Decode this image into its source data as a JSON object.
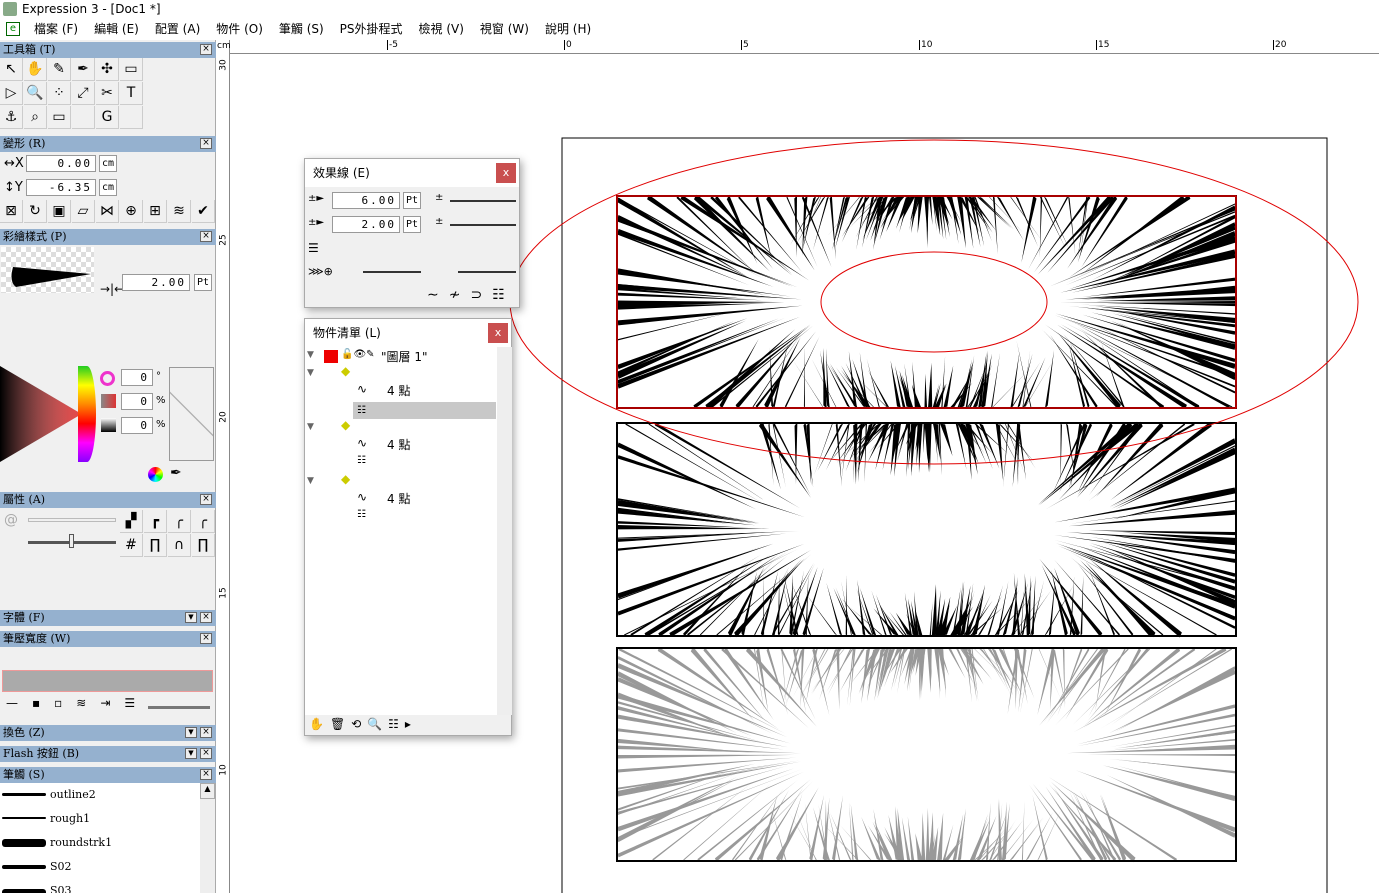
{
  "window": {
    "title": "Expression 3 - [Doc1 *]"
  },
  "menu": [
    "檔案 (F)",
    "編輯 (E)",
    "配置 (A)",
    "物件 (O)",
    "筆觸 (S)",
    "PS外掛程式",
    "檢視 (V)",
    "視窗 (W)",
    "說明 (H)"
  ],
  "panels": {
    "toolbox": {
      "title": "工具箱 (T)"
    },
    "transform": {
      "title": "變形 (R)",
      "x_value": "0.00",
      "y_value": "-6.35",
      "unit": "cm"
    },
    "paint_style": {
      "title": "彩繪樣式 (P)",
      "width_value": "2.00",
      "width_unit": "Pt",
      "hue": "0",
      "hue_unit": "°",
      "saturation": "0",
      "saturation_unit": "%",
      "brightness": "0",
      "brightness_unit": "%"
    },
    "attributes": {
      "title": "屬性 (A)"
    },
    "font": {
      "title": "字體 (F)"
    },
    "pressure": {
      "title": "筆壓寬度 (W)"
    },
    "recolor": {
      "title": "換色 (Z)"
    },
    "flash": {
      "title": "Flash 按鈕 (B)"
    },
    "strokes": {
      "title": "筆觸 (S)",
      "items": [
        "outline2",
        "rough1",
        "roundstrk1",
        "S02",
        "S03"
      ]
    }
  },
  "effect_lines": {
    "title": "效果線 (E)",
    "value1": "6.00",
    "value2": "2.00",
    "unit": "Pt",
    "close": "x"
  },
  "object_list": {
    "title": "物件清單 (L)",
    "close": "x",
    "layer_name": "\"圖層 1\"",
    "groups": [
      {
        "points": "4 點"
      },
      {
        "points": "4 點"
      },
      {
        "points": "4 點"
      }
    ]
  },
  "ruler": {
    "unit": "cm",
    "h_labels": [
      "-5",
      "0",
      "5",
      "10",
      "15",
      "20"
    ],
    "v_labels": [
      "30",
      "25",
      "20",
      "15",
      "10"
    ]
  },
  "colors": {
    "selection": "#e00000",
    "header": "#95b1cf",
    "close": "#c94f4f"
  }
}
